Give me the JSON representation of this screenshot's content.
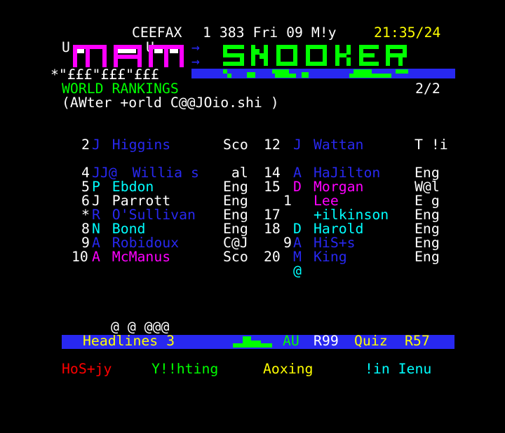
{
  "header": {
    "service": "CEEFAX",
    "page_line": "1 383 Fri 09 M!y",
    "clock": "21:35/24"
  },
  "logo": {
    "small_top_left": "U",
    "small_top_mid": "U",
    "strip_text": "*\"£££\"£££\"£££",
    "arrow_1": "→",
    "arrow_2": "→",
    "title_art": "SNOOKER",
    "strip_glyphs": "X J        J          →"
  },
  "heading": {
    "title": "WORLD RANKINGS",
    "page_count": "2/2",
    "subtitle": "(AWter +orld C@@JOio.shi )"
  },
  "rankings_left": [
    {
      "rank": "2",
      "init": "J",
      "name": "Higgins",
      "country": "Sco"
    },
    {
      "rank": "4",
      "init": "JJ@",
      "name": "Willia s",
      "country": " al"
    },
    {
      "rank": "5",
      "init": "P",
      "name": "Ebdon",
      "country": "Eng"
    },
    {
      "rank": "6",
      "init": "J",
      "name": "Parrott",
      "country": "Eng"
    },
    {
      "rank": "*",
      "init": "R",
      "name": "O'Sullivan",
      "country": "Eng"
    },
    {
      "rank": "8",
      "init": "N",
      "name": "Bond",
      "country": "Eng"
    },
    {
      "rank": "9",
      "init": "A",
      "name": "Robidoux",
      "country": "C@J"
    },
    {
      "rank": "10",
      "init": "A",
      "name": "McManus",
      "country": "Sco"
    }
  ],
  "rankings_right": [
    {
      "rank": "12",
      "init": "J",
      "name": "Wattan",
      "country": "T !i"
    },
    {
      "rank": "14",
      "init": "A",
      "name": "HaJilton",
      "country": "Eng"
    },
    {
      "rank": "15",
      "init": "D",
      "name": "Morgan",
      "country": "W@l"
    },
    {
      "rank": "1",
      "init": "",
      "name": "Lee",
      "country": "E g"
    },
    {
      "rank": "17",
      "init": "",
      "name": "+ilkinson",
      "country": "Eng"
    },
    {
      "rank": "18",
      "init": "D",
      "name": "Harold",
      "country": "Eng"
    },
    {
      "rank": "9",
      "init": "A",
      "name": "HiS+s",
      "country": "Eng"
    },
    {
      "rank": "20",
      "init": "M",
      "name": "King",
      "country": "Eng"
    }
  ],
  "stray": {
    "under_king": "@",
    "pre_footer": "@ @ @@@"
  },
  "footer": {
    "headlines": "Headlines 3",
    "au": "AU",
    "r99": "R99",
    "quiz": "Quiz",
    "r57": "R57"
  },
  "fastext": {
    "red": "HoS+jy",
    "green": "Y!!hting",
    "yellow": "Aoxing",
    "cyan": "!in Ienu"
  },
  "colors": {
    "background": "#000000",
    "white": "#ffffff",
    "yellow": "#ffff00",
    "green": "#00ff00",
    "blue": "#2828f0",
    "magenta": "#ff00ff",
    "cyan": "#00ffff",
    "red": "#ff0000"
  }
}
